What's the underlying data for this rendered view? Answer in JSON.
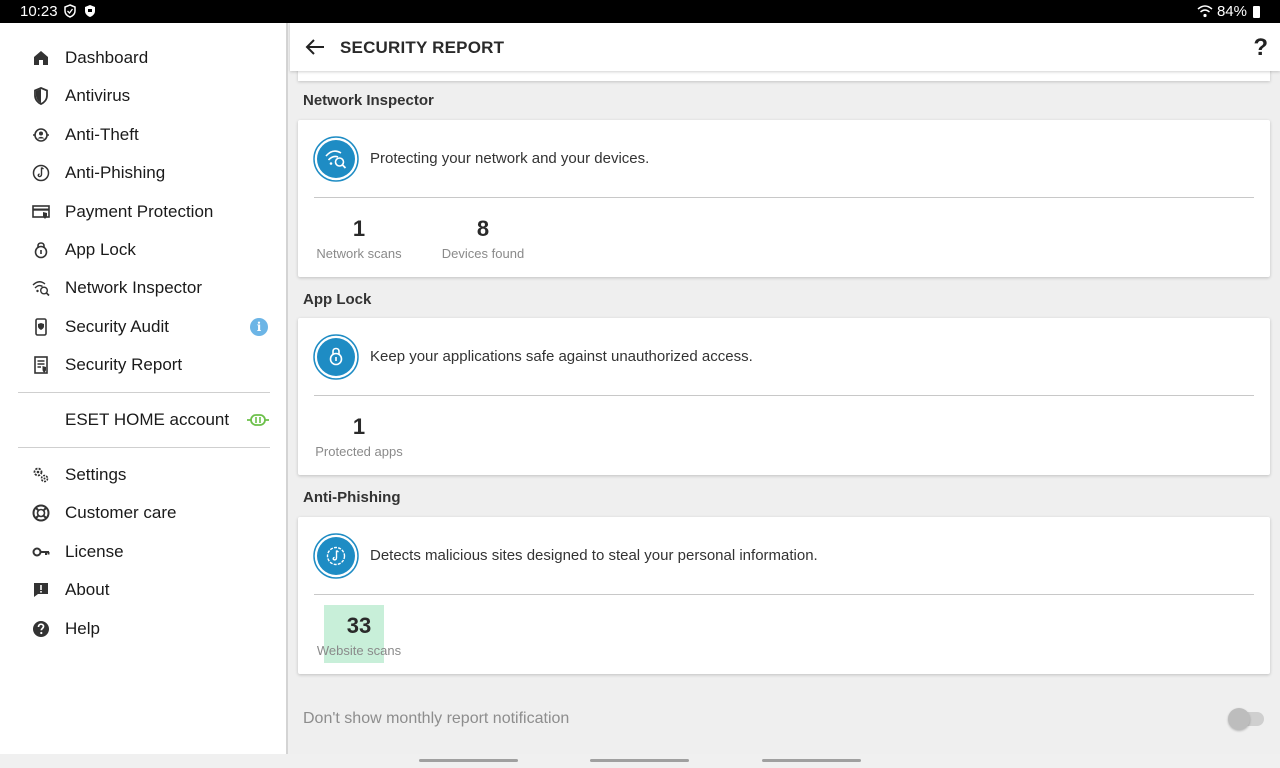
{
  "status_bar": {
    "time": "10:23",
    "battery": "84%"
  },
  "header": {
    "title": "SECURITY REPORT",
    "help": "?"
  },
  "sidebar": {
    "items": [
      {
        "label": "Dashboard",
        "icon": "home-icon"
      },
      {
        "label": "Antivirus",
        "icon": "shield-icon"
      },
      {
        "label": "Anti-Theft",
        "icon": "anti-theft-icon"
      },
      {
        "label": "Anti-Phishing",
        "icon": "anti-phishing-icon"
      },
      {
        "label": "Payment Protection",
        "icon": "payment-protection-icon"
      },
      {
        "label": "App Lock",
        "icon": "lock-icon"
      },
      {
        "label": "Network Inspector",
        "icon": "network-icon"
      },
      {
        "label": "Security Audit",
        "icon": "security-audit-icon",
        "badge": "i"
      },
      {
        "label": "Security Report",
        "icon": "report-icon"
      }
    ],
    "account": {
      "label": "ESET HOME account",
      "icon": "connected-link-icon"
    },
    "bottom_items": [
      {
        "label": "Settings",
        "icon": "settings-icon"
      },
      {
        "label": "Customer care",
        "icon": "lifebuoy-icon"
      },
      {
        "label": "License",
        "icon": "key-icon"
      },
      {
        "label": "About",
        "icon": "about-icon"
      },
      {
        "label": "Help",
        "icon": "help-icon"
      }
    ]
  },
  "sections": {
    "network": {
      "title": "Network Inspector",
      "description": "Protecting your network and your devices.",
      "stats": [
        {
          "value": "1",
          "label": "Network scans"
        },
        {
          "value": "8",
          "label": "Devices found"
        }
      ]
    },
    "applock": {
      "title": "App Lock",
      "description": "Keep your applications safe against unauthorized access.",
      "stats": [
        {
          "value": "1",
          "label": "Protected apps"
        }
      ]
    },
    "antiphishing": {
      "title": "Anti-Phishing",
      "description": "Detects malicious sites designed to steal your personal information.",
      "stats": [
        {
          "value": "33",
          "label": "Website scans"
        }
      ]
    }
  },
  "notification_toggle": {
    "label": "Don't show monthly report notification",
    "on": false
  },
  "colors": {
    "accent": "#1e8cc4",
    "badge": "#6cb5e6",
    "link_green": "#6cc04a",
    "highlight": "#c8efd9"
  }
}
